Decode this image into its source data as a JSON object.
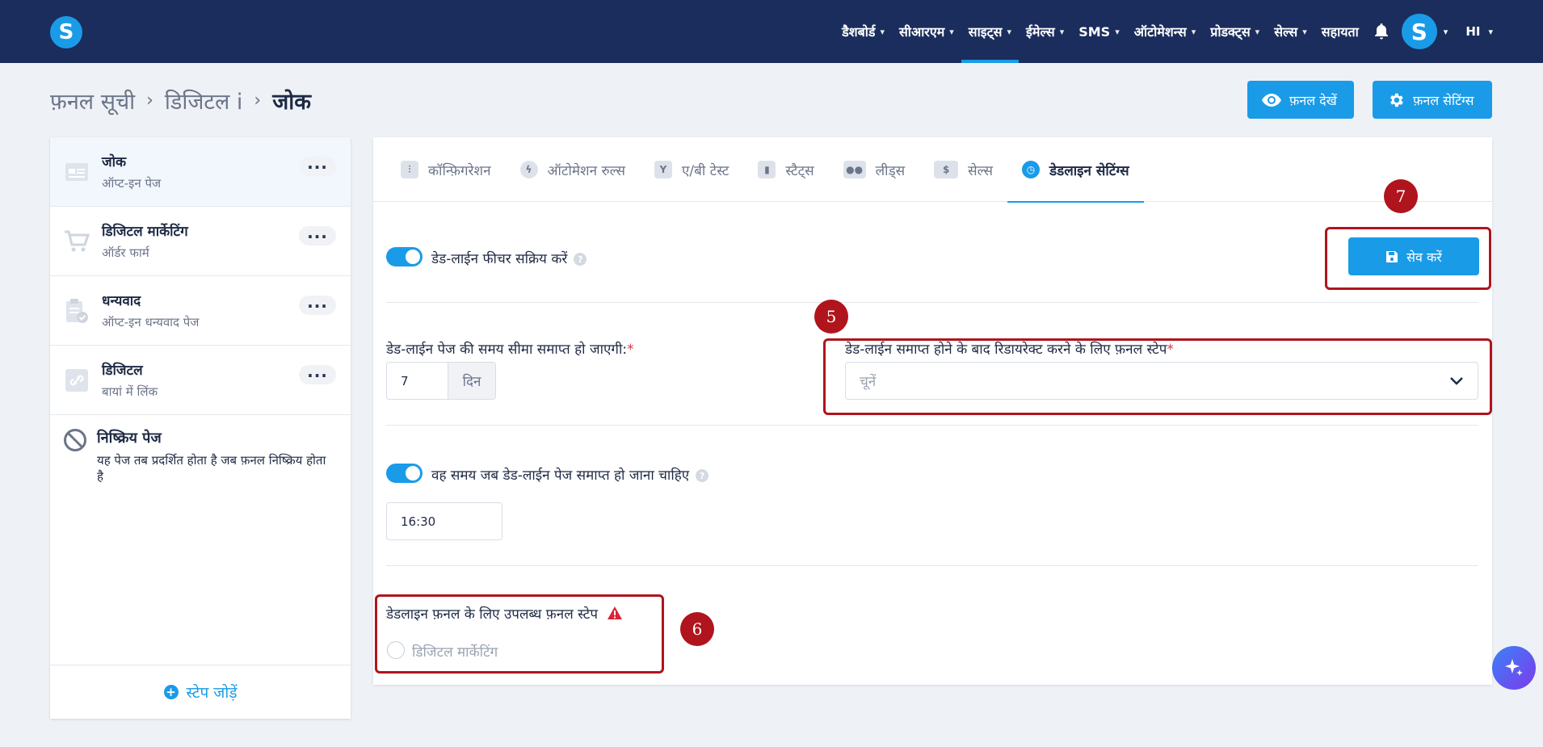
{
  "nav": {
    "items": [
      {
        "label": "डैशबोर्ड",
        "has_dropdown": true,
        "active": false
      },
      {
        "label": "सीआरएम",
        "has_dropdown": true,
        "active": false
      },
      {
        "label": "साइट्स",
        "has_dropdown": true,
        "active": true
      },
      {
        "label": "ईमेल्स",
        "has_dropdown": true,
        "active": false
      },
      {
        "label": "SMS",
        "has_dropdown": true,
        "active": false
      },
      {
        "label": "ऑटोमेशन्स",
        "has_dropdown": true,
        "active": false
      },
      {
        "label": "प्रोडक्ट्स",
        "has_dropdown": true,
        "active": false
      },
      {
        "label": "सेल्स",
        "has_dropdown": true,
        "active": false
      },
      {
        "label": "सहायता",
        "has_dropdown": false,
        "active": false
      }
    ],
    "avatar_letter": "S",
    "language": "HI",
    "logo_letter": "S"
  },
  "breadcrumb": {
    "items": [
      "फ़नल सूची",
      "डिजिटल i"
    ],
    "current": "जोक"
  },
  "header_buttons": {
    "view_funnel": "फ़नल देखें",
    "funnel_settings": "फ़नल सेटिंग्स"
  },
  "sidebar": {
    "steps": [
      {
        "title": "जोक",
        "subtitle": "ऑप्ट-इन पेज",
        "icon": "optin-page-icon"
      },
      {
        "title": "डिजिटल मार्केटिंग",
        "subtitle": "ऑर्डर फार्म",
        "icon": "cart-icon"
      },
      {
        "title": "धन्यवाद",
        "subtitle": "ऑप्ट-इन धन्यवाद पेज",
        "icon": "clipboard-check-icon"
      },
      {
        "title": "डिजिटल",
        "subtitle": "बायां में लिंक",
        "icon": "link-icon"
      }
    ],
    "inactive_page": {
      "title": "निष्क्रिय पेज",
      "description": "यह पेज तब प्रदर्शित होता है जब फ़नल निष्क्रिय होता है"
    },
    "add_step": "स्टेप जोड़ें"
  },
  "tabs": [
    {
      "label": "कॉन्फ़िगरेशन",
      "icon": "sliders-icon",
      "active": false
    },
    {
      "label": "ऑटोमेशन रुल्स",
      "icon": "bolt-icon",
      "active": false
    },
    {
      "label": "ए/बी टेस्ट",
      "icon": "split-icon",
      "active": false
    },
    {
      "label": "स्टैट्स",
      "icon": "bar-chart-icon",
      "active": false
    },
    {
      "label": "लीड्स",
      "icon": "users-icon",
      "active": false
    },
    {
      "label": "सेल्स",
      "icon": "dollar-icon",
      "active": false
    },
    {
      "label": "डेडलाइन सेटिंग्स",
      "icon": "clock-icon",
      "active": true
    }
  ],
  "deadline": {
    "enable_label": "डेड-लाईन फीचर सक्रिय करें",
    "enabled": true,
    "save_label": "सेव करें",
    "expire_label": "डेड-लाईन पेज की समय सीमा समाप्त हो जाएगी:",
    "expire_value": "7",
    "expire_unit": "दिन",
    "redirect_label": "डेड-लाईन समाप्त होने के बाद रिडायरेक्ट करने के लिए फ़नल स्टेप",
    "redirect_placeholder": "चूनें",
    "time_toggle_label": "वह समय जब डेड-लाईन पेज समाप्त हो जाना चाहिए",
    "time_enabled": true,
    "time_value": "16:30",
    "available_steps_label": "डेडलाइन फ़नल के लिए उपलब्ध फ़नल स्टेप",
    "available_steps": [
      "डिजिटल मार्केटिंग"
    ]
  },
  "annotations": [
    "7",
    "5",
    "6"
  ],
  "colors": {
    "nav_bg": "#1a2d5c",
    "accent": "#1a9be8",
    "annotation_red": "#b0141c"
  }
}
